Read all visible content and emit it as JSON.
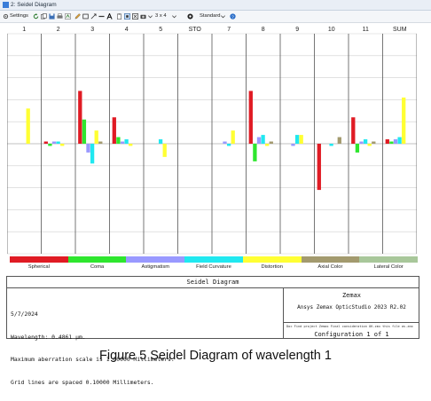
{
  "window": {
    "title": "2: Seidel Diagram"
  },
  "toolbar": {
    "settings_label": "Settings",
    "layout_label": "3 x 4",
    "standard_label": "Standard"
  },
  "chart_data": {
    "type": "bar",
    "categories": [
      "1",
      "2",
      "3",
      "4",
      "5",
      "STO",
      "7",
      "8",
      "9",
      "10",
      "11",
      "SUM"
    ],
    "ylim": [
      -0.5,
      0.5
    ],
    "grid": true,
    "grid_spacing": 0.1,
    "series": [
      {
        "name": "Spherical",
        "color": "#e01b24",
        "values": [
          0.0,
          0.01,
          0.24,
          0.12,
          0.0,
          0.0,
          0.0,
          0.24,
          0.0,
          -0.21,
          0.12,
          0.02
        ]
      },
      {
        "name": "Coma",
        "color": "#2ee62e",
        "values": [
          0.0,
          -0.01,
          0.11,
          0.03,
          0.0,
          0.0,
          0.0,
          -0.08,
          0.0,
          0.0,
          -0.04,
          0.01
        ]
      },
      {
        "name": "Astigmatism",
        "color": "#9999ff",
        "values": [
          0.0,
          0.01,
          -0.04,
          0.01,
          0.0,
          0.0,
          0.01,
          0.03,
          -0.01,
          0.0,
          0.01,
          0.02
        ]
      },
      {
        "name": "Field Curvature",
        "color": "#20e8f0",
        "values": [
          0.0,
          0.01,
          -0.09,
          0.02,
          0.02,
          0.0,
          -0.01,
          0.04,
          0.04,
          -0.01,
          0.02,
          0.03
        ]
      },
      {
        "name": "Distortion",
        "color": "#ffff33",
        "values": [
          0.16,
          -0.01,
          0.06,
          -0.01,
          -0.06,
          0.0,
          0.06,
          -0.01,
          0.04,
          0.0,
          -0.01,
          0.21
        ]
      },
      {
        "name": "Axial Color",
        "color": "#a39a6e",
        "values": [
          0.0,
          0.0,
          0.01,
          0.0,
          0.0,
          0.0,
          0.0,
          0.01,
          0.0,
          0.03,
          0.01,
          0.0
        ]
      },
      {
        "name": "Lateral Color",
        "color": "#a8c79a",
        "values": [
          0.0,
          0.0,
          0.0,
          0.0,
          0.0,
          0.0,
          0.0,
          0.0,
          0.0,
          0.0,
          0.0,
          0.0
        ]
      }
    ]
  },
  "info": {
    "panel_title": "Seidel Diagram",
    "lines": [
      "5/7/2024",
      "Wavelength: 0.4861 µm.",
      "Maximum aberration scale is 1.00000 Millimeters.",
      "Grid lines are spaced 0.10000 Millimeters."
    ],
    "company": "Zemax",
    "product": "Ansys Zemax OpticStudio 2023 R2.02",
    "file_path": "Doc Find project Zemax Final consideration OK.zmx   this file as.zmx",
    "configuration": "Configuration 1 of 1"
  },
  "caption": "Figure 5 Seidel Diagram of wavelength 1"
}
